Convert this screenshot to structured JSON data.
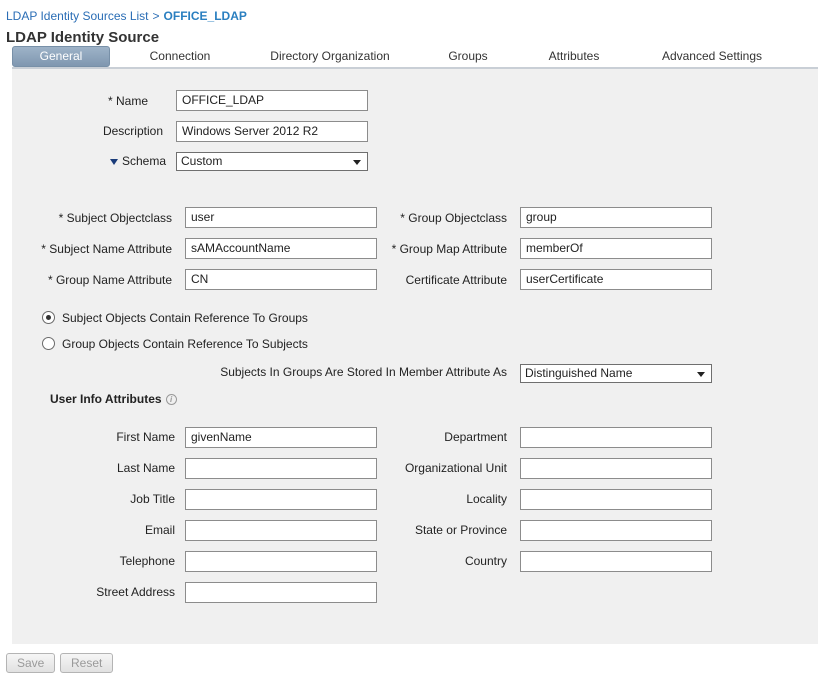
{
  "breadcrumb": {
    "parent": "LDAP Identity Sources List",
    "separator": ">",
    "current": "OFFICE_LDAP"
  },
  "page_title": "LDAP Identity Source",
  "tabs": [
    {
      "label": "General",
      "active": true
    },
    {
      "label": "Connection"
    },
    {
      "label": "Directory Organization"
    },
    {
      "label": "Groups"
    },
    {
      "label": "Attributes"
    },
    {
      "label": "Advanced Settings"
    }
  ],
  "general": {
    "name_label": "* Name",
    "name_value": "OFFICE_LDAP",
    "description_label": "Description",
    "description_value": "Windows Server 2012 R2",
    "schema_label": "Schema",
    "schema_value": "Custom"
  },
  "schema": {
    "subject_objectclass_label": "* Subject Objectclass",
    "subject_objectclass_value": "user",
    "subject_name_attr_label": "* Subject Name Attribute",
    "subject_name_attr_value": "sAMAccountName",
    "group_name_attr_label": "* Group Name Attribute",
    "group_name_attr_value": "CN",
    "group_objectclass_label": "* Group Objectclass",
    "group_objectclass_value": "group",
    "group_map_attr_label": "* Group Map Attribute",
    "group_map_attr_value": "memberOf",
    "certificate_attr_label": "Certificate Attribute",
    "certificate_attr_value": "userCertificate"
  },
  "reference": {
    "option_subject_label": "Subject Objects Contain Reference To Groups",
    "option_group_label": "Group Objects Contain Reference To Subjects",
    "stored_as_label": "Subjects In Groups Are Stored In Member Attribute As",
    "stored_as_value": "Distinguished Name"
  },
  "user_info": {
    "heading": "User Info Attributes",
    "first_name_label": "First Name",
    "first_name_value": "givenName",
    "last_name_label": "Last Name",
    "last_name_value": "",
    "job_title_label": "Job Title",
    "job_title_value": "",
    "email_label": "Email",
    "email_value": "",
    "telephone_label": "Telephone",
    "telephone_value": "",
    "street_label": "Street Address",
    "street_value": "",
    "department_label": "Department",
    "department_value": "",
    "org_unit_label": "Organizational Unit",
    "org_unit_value": "",
    "locality_label": "Locality",
    "locality_value": "",
    "state_label": "State or Province",
    "state_value": "",
    "country_label": "Country",
    "country_value": ""
  },
  "footer": {
    "save_label": "Save",
    "reset_label": "Reset"
  },
  "icons": {
    "info": "info-icon",
    "schema_toggle": "triangle-down-icon"
  }
}
